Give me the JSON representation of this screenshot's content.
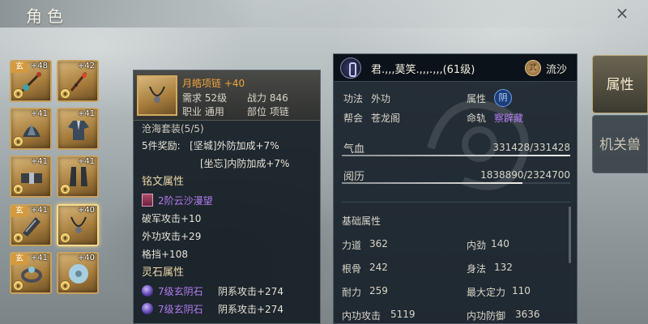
{
  "window": {
    "title": "角色",
    "close_symbol": "×"
  },
  "equipment": [
    {
      "name": "weapon-staff",
      "badge": "玄",
      "level": "+48",
      "bound": true
    },
    {
      "name": "weapon-brush",
      "badge": "",
      "level": "+42",
      "bound": true
    },
    {
      "name": "helmet",
      "badge": "",
      "level": "+41",
      "bound": true
    },
    {
      "name": "robe",
      "badge": "",
      "level": "+41",
      "bound": false
    },
    {
      "name": "belt",
      "badge": "",
      "level": "+41",
      "bound": true
    },
    {
      "name": "boots",
      "badge": "",
      "level": "+41",
      "bound": true
    },
    {
      "name": "bracer",
      "badge": "玄",
      "level": "+41",
      "bound": true
    },
    {
      "name": "necklace",
      "badge": "",
      "level": "+40",
      "bound": true,
      "selected": true
    },
    {
      "name": "ring",
      "badge": "玄",
      "level": "+41",
      "bound": true
    },
    {
      "name": "jade-pendant",
      "badge": "",
      "level": "+40",
      "bound": true
    }
  ],
  "tooltip": {
    "item_name": "月皓项链",
    "item_plus": "+40",
    "require_label": "需求",
    "require_value": "52级",
    "power_label": "战力",
    "power_value": "846",
    "class_label": "职业",
    "class_value": "通用",
    "slot_label": "部位",
    "slot_value": "项链",
    "set_name": "沧海套装(5/5)",
    "set_bonus_label": "5件奖励:",
    "set_bonus_1": "[坚城]外防加成+7%",
    "set_bonus_2": "[坐忘]内防加成+7%",
    "inscription_title": "铭文属性",
    "inscription_name": "2阶云沙漫望",
    "inscription_stats": [
      "破军攻击+10",
      "外功攻击+29",
      "格挡+108"
    ],
    "gem_title": "灵石属性",
    "gems": [
      {
        "name": "7级玄阴石",
        "stat": "阴系攻击+274"
      },
      {
        "name": "7级玄阴石",
        "stat": "阴系攻击+274"
      }
    ]
  },
  "character": {
    "name": "君.,,,莫笑.,,,.,,,(61级)",
    "sect_badge": "武",
    "sect_name": "流沙",
    "skill_label": "功法",
    "skill_value": "外功",
    "attr_label": "属性",
    "attr_value": "阴",
    "guild_label": "帮会",
    "guild_value": "苍龙阁",
    "destiny_label": "命轨",
    "destiny_value": "察辟藏",
    "hp_label": "气血",
    "hp_value": "331428/331428",
    "hp_fraction": 1.0,
    "exp_label": "阅历",
    "exp_value": "1838890/2324700",
    "exp_fraction": 0.791,
    "base_title": "基础属性",
    "stats_left": [
      {
        "label": "力道",
        "value": "362"
      },
      {
        "label": "根骨",
        "value": "242"
      },
      {
        "label": "耐力",
        "value": "259"
      },
      {
        "label": "内功攻击",
        "value": "5119"
      }
    ],
    "stats_right": [
      {
        "label": "内劲",
        "value": "140"
      },
      {
        "label": "身法",
        "value": "132"
      },
      {
        "label": "最大定力",
        "value": "110"
      },
      {
        "label": "内功防御",
        "value": "3636"
      }
    ]
  },
  "tabs": [
    {
      "label": "属性",
      "active": true
    },
    {
      "label": "机关兽",
      "active": false
    }
  ],
  "colors": {
    "orange": "#f0a43a",
    "purple": "#b27df0",
    "gold": "#e9d7a9"
  }
}
